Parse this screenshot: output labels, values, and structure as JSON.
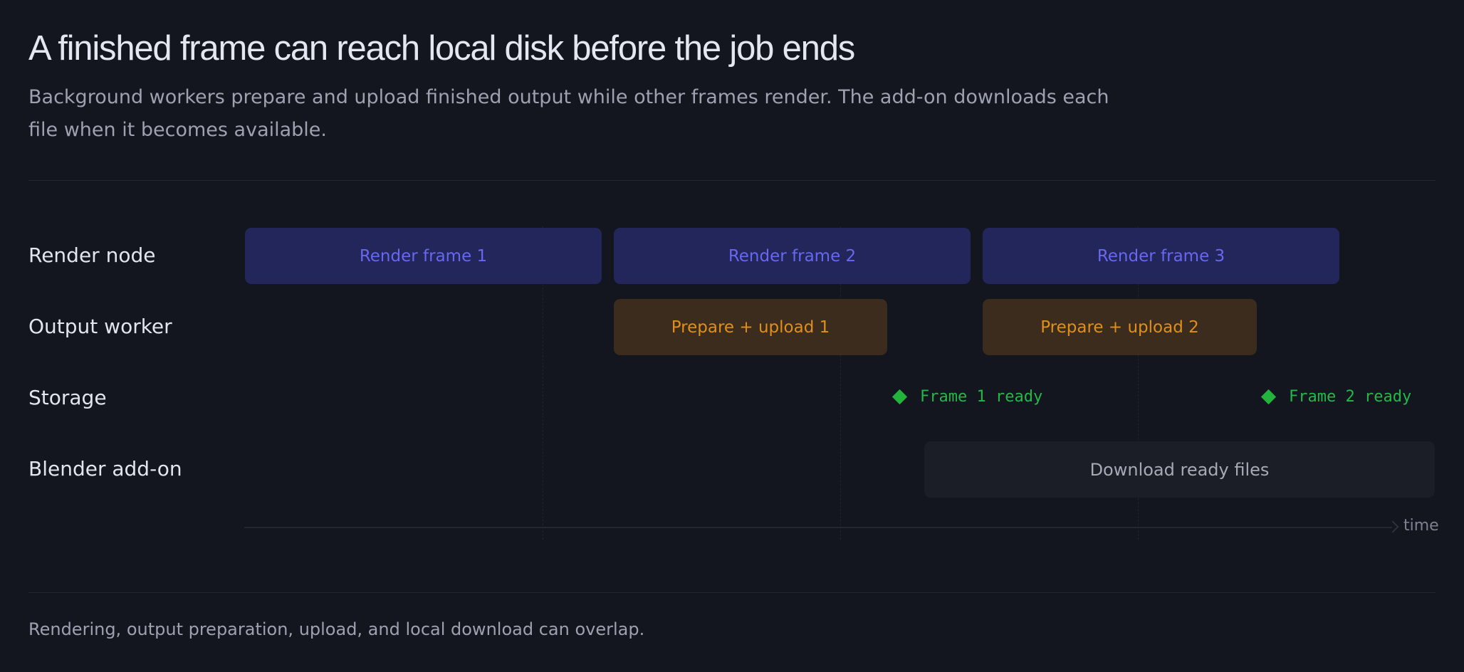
{
  "header": {
    "title": "A finished frame can reach local disk before the job ends",
    "subtitle": "Background workers prepare and upload finished output while other frames render. The add-on downloads each file when it becomes available."
  },
  "diagram": {
    "lanes": [
      {
        "label": "Render node"
      },
      {
        "label": "Output worker"
      },
      {
        "label": "Storage"
      },
      {
        "label": "Blender add-on"
      }
    ],
    "render_bars": [
      {
        "label": "Render frame 1"
      },
      {
        "label": "Render frame 2"
      },
      {
        "label": "Render frame 3"
      }
    ],
    "upload_bars": [
      {
        "label": "Prepare + upload 1"
      },
      {
        "label": "Prepare + upload 2"
      }
    ],
    "milestones": [
      {
        "label": "Frame 1 ready"
      },
      {
        "label": "Frame 2 ready"
      }
    ],
    "download_bar": {
      "label": "Download ready files"
    },
    "axis_label": "time"
  },
  "footer": {
    "caption": "Rendering, output preparation, upload, and local download can overlap."
  },
  "colors": {
    "background": "#13161e",
    "render_fill": "#23265a",
    "render_text": "#6767f0",
    "upload_fill": "#3b2c1d",
    "upload_text": "#e08f18",
    "milestone": "#22b43c",
    "download_fill": "#1b1e26"
  }
}
